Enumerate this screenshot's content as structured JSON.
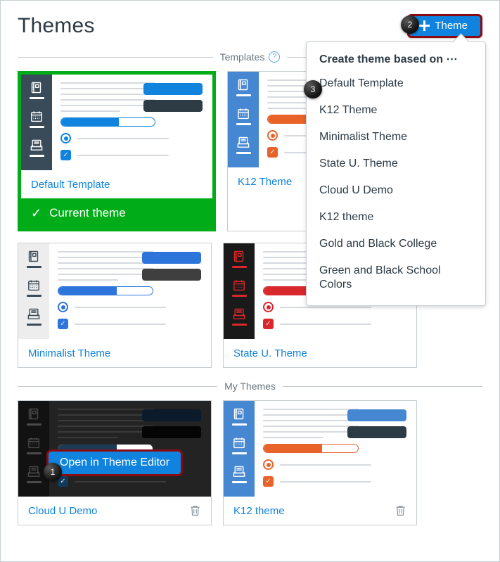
{
  "header": {
    "title": "Themes",
    "add_theme_label": "Theme",
    "add_theme_icon": "plus-icon"
  },
  "callouts": [
    {
      "id": "1",
      "number": "1",
      "target": "open-in-theme-editor-button"
    },
    {
      "id": "2",
      "number": "2",
      "target": "add-theme-button"
    },
    {
      "id": "3",
      "number": "3",
      "target": "dropdown-item-default-template"
    }
  ],
  "sections": [
    {
      "key": "templates",
      "label": "Templates",
      "help_icon": "question-mark-icon"
    },
    {
      "key": "my_themes",
      "label": "My Themes",
      "help_icon": null
    }
  ],
  "dropdown": {
    "title": "Create theme based on ⋯",
    "items": [
      "Default Template",
      "K12 Theme",
      "Minimalist Theme",
      "State U. Theme",
      "Cloud U Demo",
      "K12 theme",
      "Gold and Black College",
      "Green and Black School Colors"
    ]
  },
  "templates": [
    {
      "name": "Default Template",
      "current": true,
      "current_label": "Current theme",
      "current_icon": "check-icon",
      "colors": {
        "sidebar_bg": "#394B58",
        "sidebar_icon": "#ffffff",
        "accent": "#0f83dd",
        "progress_border": "#0f83dd",
        "progress_fill": "#0f83dd",
        "pill_primary": "#0f83dd",
        "pill_secondary": "#2D3B45",
        "body_bg": "#ffffff"
      }
    },
    {
      "name": "K12 Theme",
      "current": false,
      "colors": {
        "sidebar_bg": "#4687D1",
        "sidebar_icon": "#ffffff",
        "accent": "#E8632A",
        "progress_border": "#E8632A",
        "progress_fill": "#E8632A",
        "pill_primary": "#4687D1",
        "pill_secondary": "#2D3B45",
        "body_bg": "#ffffff"
      }
    },
    {
      "name": "Minimalist Theme",
      "current": false,
      "colors": {
        "sidebar_bg": "#EDEDED",
        "sidebar_icon": "#3B4A55",
        "accent": "#2D75DB",
        "progress_border": "#2D75DB",
        "progress_fill": "#2D75DB",
        "pill_primary": "#2D75DB",
        "pill_secondary": "#3F3F3F",
        "body_bg": "#ffffff"
      }
    },
    {
      "name": "State U. Theme",
      "current": false,
      "colors": {
        "sidebar_bg": "#1A1A1A",
        "sidebar_icon": "#D8282C",
        "accent": "#D8282C",
        "progress_border": "#D8282C",
        "progress_fill": "#D8282C",
        "pill_primary": "#D8282C",
        "pill_secondary": "#1A1A1A",
        "body_bg": "#ffffff"
      }
    }
  ],
  "my_themes": [
    {
      "name": "Cloud U Demo",
      "delete_icon": "trash-icon",
      "hovered": true,
      "overlay_button_label": "Open in Theme Editor",
      "colors": {
        "sidebar_bg": "#121212",
        "sidebar_icon": "#4A4A4A",
        "accent": "#123A5C",
        "progress_border": "#2A2A2A",
        "progress_fill": "#1B3A55",
        "pill_primary": "#0B1B2B",
        "pill_secondary": "#050505",
        "body_bg": "#232323"
      }
    },
    {
      "name": "K12 theme",
      "delete_icon": "trash-icon",
      "hovered": false,
      "colors": {
        "sidebar_bg": "#4687D1",
        "sidebar_icon": "#ffffff",
        "accent": "#E8632A",
        "progress_border": "#E8632A",
        "progress_fill": "#E8632A",
        "pill_primary": "#4687D1",
        "pill_secondary": "#2D3B45",
        "body_bg": "#ffffff"
      }
    }
  ],
  "icons": {
    "sidebar": [
      "book-icon",
      "calendar-icon",
      "inbox-icon"
    ]
  }
}
